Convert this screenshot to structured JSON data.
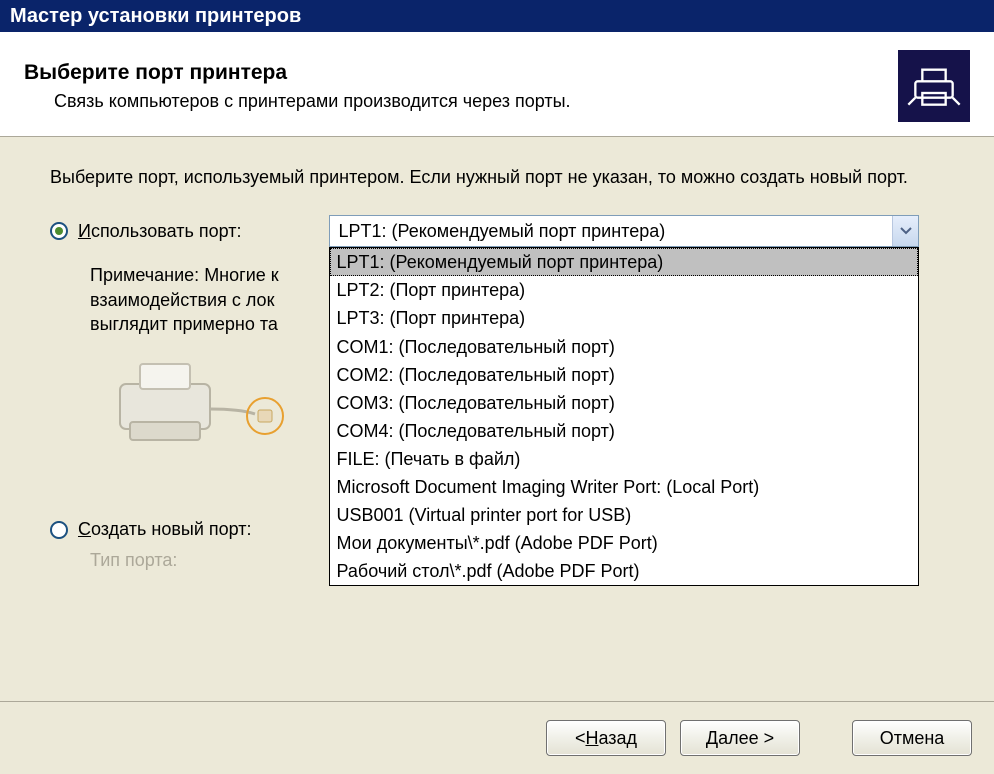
{
  "window": {
    "title": "Мастер установки принтеров"
  },
  "header": {
    "title": "Выберите порт принтера",
    "subtitle": "Связь компьютеров с принтерами производится через порты."
  },
  "body": {
    "instruction": "Выберите порт, используемый принтером. Если нужный порт не указан, то можно создать новый порт.",
    "use_port": {
      "prefix": "И",
      "rest": "спользовать порт:"
    },
    "combo_selected": "LPT1: (Рекомендуемый порт принтера)",
    "dropdown": [
      "LPT1: (Рекомендуемый порт принтера)",
      "LPT2: (Порт принтера)",
      "LPT3: (Порт принтера)",
      "COM1: (Последовательный порт)",
      "COM2: (Последовательный порт)",
      "COM3: (Последовательный порт)",
      "COM4: (Последовательный порт)",
      "FILE: (Печать в файл)",
      "Microsoft Document Imaging Writer Port: (Local Port)",
      "USB001 (Virtual printer port for USB)",
      "Мои документы\\*.pdf (Adobe PDF Port)",
      "Рабочий стол\\*.pdf (Adobe PDF Port)"
    ],
    "note_line1": "Примечание: Многие к",
    "note_line2": "взаимодействия с лок",
    "note_line3": "выглядит примерно та",
    "create_port": {
      "prefix": "С",
      "rest": "оздать новый порт:"
    },
    "type_label": "Тип порта:"
  },
  "footer": {
    "back_prefix": "< ",
    "back_u": "Н",
    "back_rest": "азад",
    "next_prefix": "",
    "next_u": "Д",
    "next_rest": "алее >",
    "cancel": "Отмена"
  }
}
